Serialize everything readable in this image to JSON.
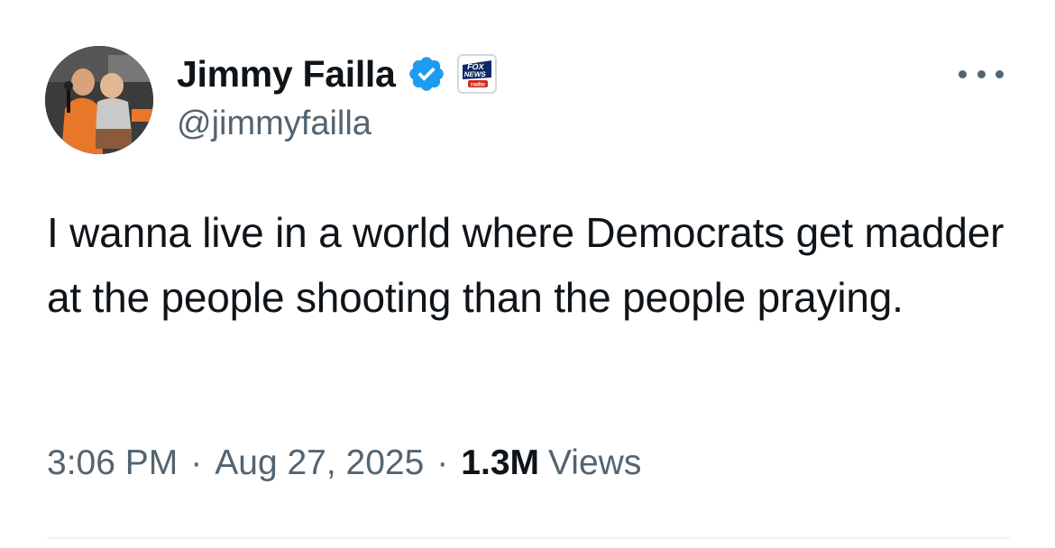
{
  "author": {
    "display_name": "Jimmy Failla",
    "handle": "@jimmyfailla",
    "verified": true,
    "verified_color": "#1d9bf0",
    "affiliate_badge_icon": "fox-news-radio-logo",
    "affiliate_badge_text": [
      "FOX",
      "NEWS",
      "radio"
    ]
  },
  "tweet": {
    "text": "I wanna live in a world where Democrats get madder at the people shooting than the people praying.",
    "time": "3:06 PM",
    "date": "Aug 27, 2025",
    "separator": "·",
    "views_count": "1.3M",
    "views_label": "Views"
  },
  "colors": {
    "text_primary": "#0f1419",
    "text_secondary": "#536471",
    "divider": "#eff3f4"
  }
}
